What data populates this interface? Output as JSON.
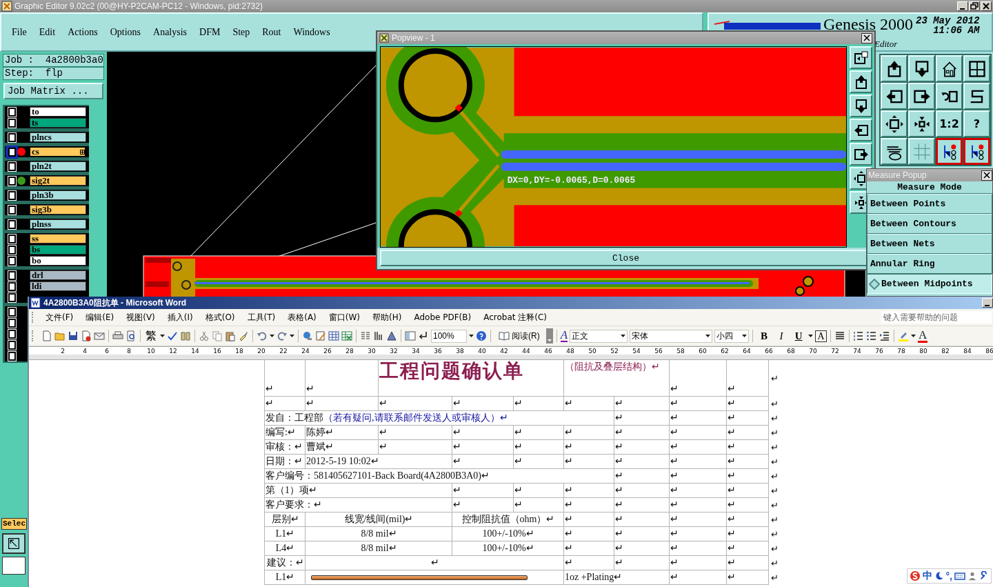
{
  "genesis": {
    "title": "Graphic Editor 9.02c2 (00@HY-P2CAM-PC12 - Windows, pid:2732)",
    "menu": [
      "File",
      "Edit",
      "Actions",
      "Options",
      "Analysis",
      "DFM",
      "Step",
      "Rout",
      "Windows"
    ],
    "brand": {
      "name": "Genesis 2000",
      "date": "23 May 2012",
      "time": "11:06 AM",
      "subtitle": "Editor"
    },
    "job": "Job :  4a2800b3a0",
    "step": "Step:  flp",
    "job_matrix_button": "Job Matrix ...",
    "layer_groups": [
      {
        "layers": [
          {
            "name": "to",
            "color": "#ffffff",
            "checked": false,
            "selected": false
          },
          {
            "name": "ts",
            "color": "#00a67c",
            "checked": false,
            "selected": false
          }
        ]
      },
      {
        "layers": [
          {
            "name": "plncs",
            "color": "#a8dede",
            "checked": false,
            "selected": false
          }
        ]
      },
      {
        "layers": [
          {
            "name": "cs",
            "color": "#ffc95c",
            "checked": false,
            "selected": true,
            "dot": {
              "color": "#ff0000"
            }
          }
        ]
      },
      {
        "layers": [
          {
            "name": "pln2t",
            "color": "#a8dede",
            "checked": false,
            "selected": false
          }
        ]
      },
      {
        "layers": [
          {
            "name": "sig2t",
            "color": "#ffc95c",
            "checked": false,
            "selected": false,
            "dot": {
              "color": "#3c9a1a"
            }
          }
        ]
      },
      {
        "layers": [
          {
            "name": "pln3b",
            "color": "#a8dede",
            "checked": false,
            "selected": false
          }
        ]
      },
      {
        "layers": [
          {
            "name": "sig3b",
            "color": "#ffc95c",
            "checked": false,
            "selected": false
          }
        ]
      },
      {
        "layers": [
          {
            "name": "plnss",
            "color": "#a8dede",
            "checked": false,
            "selected": false
          }
        ]
      },
      {
        "layers": [
          {
            "name": "ss",
            "color": "#ffc95c",
            "checked": false,
            "selected": false
          },
          {
            "name": "bs",
            "color": "#00a67c",
            "checked": false,
            "selected": false
          },
          {
            "name": "bo",
            "color": "#ffffff",
            "checked": false,
            "selected": false
          }
        ]
      },
      {
        "layers": [
          {
            "name": "drl",
            "color": "#a8b8c4",
            "checked": false,
            "selected": false
          },
          {
            "name": "ldi",
            "color": "#a8b8c4",
            "checked": false,
            "selected": false
          },
          {
            "checked": false,
            "selected": false
          }
        ]
      },
      {
        "layers": [
          {
            "checked": false,
            "selected": false
          },
          {
            "checked": false,
            "selected": false
          },
          {
            "checked": false,
            "selected": false
          },
          {
            "checked": false,
            "selected": false
          },
          {
            "checked": false,
            "selected": false
          }
        ]
      }
    ],
    "select_label": "Selec",
    "view_tools": [
      {
        "highlighted": false
      },
      {
        "highlighted": false
      },
      {
        "highlighted": false
      },
      {
        "highlighted": false
      },
      {
        "highlighted": false
      },
      {
        "highlighted": false
      },
      {
        "highlighted": false
      },
      {
        "highlighted": false
      },
      {
        "highlighted": false
      },
      {
        "highlighted": false
      },
      {
        "label": "1:2",
        "highlighted": false
      },
      {
        "label": "?",
        "highlighted": false
      },
      {
        "highlighted": false
      },
      {
        "highlighted": false
      },
      {
        "highlighted": true
      },
      {
        "highlighted": true
      }
    ]
  },
  "popview": {
    "title": "Popview - 1",
    "measurement": "DX=0,DY=-0.0065,D=0.0065",
    "close_button": "Close"
  },
  "measure_popup": {
    "title": "Measure Popup",
    "heading": "Measure Mode",
    "options": [
      {
        "label": "Between Points",
        "selected": false
      },
      {
        "label": "Between Contours",
        "selected": false
      },
      {
        "label": "Between Nets",
        "selected": false
      },
      {
        "label": "Annular Ring",
        "selected": false
      },
      {
        "label": "Between Midpoints",
        "selected": true
      }
    ]
  },
  "word": {
    "title": "4A2800B3A0阻抗单 - Microsoft Word",
    "menu": [
      "文件(F)",
      "编辑(E)",
      "视图(V)",
      "插入(I)",
      "格式(O)",
      "工具(T)",
      "表格(A)",
      "窗口(W)",
      "帮助(H)",
      "Adobe PDF(B)",
      "Acrobat 注释(C)"
    ],
    "help": {
      "placeholder": "键入需要帮助的问题"
    },
    "toolbar": {
      "convert": "繁",
      "zoom": "100%",
      "read": "阅读(R)",
      "styles_icon": "A",
      "style": "正文",
      "font": "宋体",
      "size": "小四",
      "format": [
        {
          "label": "B",
          "kind": "bold"
        },
        {
          "label": "I",
          "kind": "italic"
        },
        {
          "label": "U",
          "kind": "underline"
        },
        {
          "label": "A",
          "kind": "boxed"
        }
      ],
      "font_color": "A"
    },
    "ruler": [
      "2",
      "4",
      "6",
      "8",
      "10",
      "12",
      "14",
      "16",
      "18",
      "20",
      "22",
      "24",
      "26",
      "28",
      "30",
      "32",
      "34",
      "36",
      "38",
      "40",
      "42",
      "44",
      "46",
      "48",
      "50",
      "52",
      "54",
      "56",
      "58",
      "60",
      "62",
      "64",
      "66",
      "68",
      "70",
      "72",
      "74",
      "76",
      "78",
      "80",
      "82",
      "84",
      "86"
    ],
    "table": [
      {
        "kind": "title",
        "cells": [
          {
            "text": "↵"
          },
          {
            "text": "↵"
          },
          {
            "text": "工程问题确认单",
            "kind": "title"
          },
          {
            "text": "（阻抗及叠层结构）↵",
            "kind": "subtitle"
          },
          {
            "text": "↵"
          },
          {
            "text": "↵"
          }
        ],
        "end": "↵"
      },
      {
        "kind": "grid",
        "cells": [
          {
            "text": "↵"
          },
          {
            "text": "↵"
          },
          {
            "text": "↵"
          },
          {
            "text": "↵"
          },
          {
            "text": "↵"
          },
          {
            "text": "↵"
          },
          {
            "text": "↵"
          },
          {
            "text": "↵"
          },
          {
            "text": "↵"
          }
        ],
        "end": "↵"
      },
      {
        "kind": "wide",
        "cells": [
          {
            "parts": [
              {
                "text": "发自：工程部",
                "kind": "plain"
              },
              {
                "text": "（若有疑问,请联系邮件发送人或审核人）↵",
                "kind": "note"
              }
            ]
          },
          {
            "text": "↵"
          },
          {
            "text": "↵"
          },
          {
            "text": "↵"
          }
        ],
        "end": "↵"
      },
      {
        "kind": "grid",
        "cells": [
          {
            "text": "编写:↵"
          },
          {
            "text": "陈婷↵"
          },
          {
            "text": "↵"
          },
          {
            "text": "↵"
          },
          {
            "text": "↵"
          },
          {
            "text": "↵"
          },
          {
            "text": "↵"
          },
          {
            "text": "↵"
          },
          {
            "text": "↵"
          }
        ],
        "end": "↵"
      },
      {
        "kind": "grid",
        "cells": [
          {
            "text": "审核：↵"
          },
          {
            "text": "曹斌↵"
          },
          {
            "text": "↵"
          },
          {
            "text": "↵"
          },
          {
            "text": "↵"
          },
          {
            "text": "↵"
          },
          {
            "text": "↵"
          },
          {
            "text": "↵"
          },
          {
            "text": "↵"
          }
        ],
        "end": "↵"
      },
      {
        "kind": "date",
        "cells": [
          {
            "text": "日期：↵"
          },
          {
            "text": "2012-5-19 10:02↵"
          },
          {
            "text": "↵"
          },
          {
            "text": "↵"
          },
          {
            "text": "↵"
          },
          {
            "text": "↵"
          },
          {
            "text": "↵"
          },
          {
            "text": "↵"
          }
        ],
        "end": "↵"
      },
      {
        "kind": "wide",
        "cells": [
          {
            "text": "客户编号：581405627101-Back Board(4A2800B3A0)↵"
          },
          {
            "text": "↵"
          },
          {
            "text": "↵"
          },
          {
            "text": "↵"
          }
        ],
        "end": "↵"
      },
      {
        "kind": "item",
        "cells": [
          {
            "text": "第（1）项↵"
          },
          {
            "text": "↵"
          },
          {
            "text": "↵"
          },
          {
            "text": "↵"
          },
          {
            "text": "↵"
          },
          {
            "text": "↵"
          },
          {
            "text": "↵"
          }
        ],
        "end": "↵"
      },
      {
        "kind": "item",
        "cells": [
          {
            "text": "客户要求：↵"
          },
          {
            "text": "↵"
          },
          {
            "text": "↵"
          },
          {
            "text": "↵"
          },
          {
            "text": "↵"
          },
          {
            "text": "↵"
          },
          {
            "text": "↵"
          }
        ],
        "end": "↵"
      },
      {
        "kind": "impedance",
        "cells": [
          {
            "text": "层别↵",
            "kind": "centered"
          },
          {
            "text": "线宽/线间(mil)↵",
            "kind": "centered"
          },
          {
            "text": "控制阻抗值（ohm）↵",
            "kind": "centered"
          },
          {
            "text": "↵"
          },
          {
            "text": "↵"
          },
          {
            "text": "↵"
          },
          {
            "text": "↵"
          }
        ],
        "end": "↵"
      },
      {
        "kind": "impedance",
        "cells": [
          {
            "text": "L1↵",
            "kind": "centered"
          },
          {
            "text": "8/8 mil↵",
            "kind": "centered"
          },
          {
            "text": "100+/-10%↵",
            "kind": "centered"
          },
          {
            "text": "↵"
          },
          {
            "text": "↵"
          },
          {
            "text": "↵"
          },
          {
            "text": "↵"
          }
        ],
        "end": "↵"
      },
      {
        "kind": "impedance",
        "cells": [
          {
            "text": "L4↵",
            "kind": "centered"
          },
          {
            "text": "8/8 mil↵",
            "kind": "centered"
          },
          {
            "text": "100+/-10%↵",
            "kind": "centered"
          },
          {
            "text": "↵"
          },
          {
            "text": "↵"
          },
          {
            "text": "↵"
          },
          {
            "text": "↵"
          }
        ],
        "end": "↵"
      },
      {
        "kind": "advice",
        "cells": [
          {
            "text": "建议：↵",
            "kind": "centered"
          },
          {
            "text": "↵",
            "kind": "centered"
          },
          {
            "text": "↵"
          },
          {
            "text": "↵"
          },
          {
            "text": "↵"
          },
          {
            "text": "↵"
          }
        ],
        "end": "↵"
      },
      {
        "kind": "stack",
        "cells": [
          {
            "text": "L1↵",
            "kind": "centered"
          },
          {
            "kind": "bar"
          },
          {
            "text": "1oz +Plating↵"
          },
          {
            "text": "↵"
          },
          {
            "text": "↵"
          }
        ],
        "end": "↵"
      }
    ],
    "ime": {
      "mode": "中",
      "punct": "°,"
    }
  }
}
